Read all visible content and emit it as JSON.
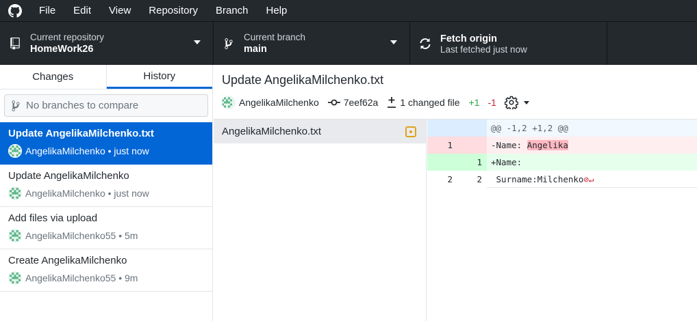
{
  "menu": {
    "items": [
      "File",
      "Edit",
      "View",
      "Repository",
      "Branch",
      "Help"
    ]
  },
  "toolbar": {
    "repository": {
      "label": "Current repository",
      "value": "HomeWork26"
    },
    "branch": {
      "label": "Current branch",
      "value": "main"
    },
    "fetch": {
      "label": "Fetch origin",
      "value": "Last fetched just now"
    }
  },
  "sidebar": {
    "tabs": {
      "changes": "Changes",
      "history": "History"
    },
    "compare_placeholder": "No branches to compare",
    "commits": [
      {
        "title": "Update AngelikaMilchenko.txt",
        "meta": "AngelikaMilchenko • just now"
      },
      {
        "title": "Update AngelikaMilchenko",
        "meta": "AngelikaMilchenko • just now"
      },
      {
        "title": "Add files via upload",
        "meta": "AngelikaMilchenko55 • 5m"
      },
      {
        "title": "Create AngelikaMilchenko",
        "meta": "AngelikaMilchenko55 • 9m"
      }
    ]
  },
  "commit": {
    "title": "Update AngelikaMilchenko.txt",
    "author": "AngelikaMilchenko",
    "sha": "7eef62a",
    "changed_files": "1 changed file",
    "additions": "+1",
    "deletions": "-1"
  },
  "files": [
    {
      "name": "AngelikaMilchenko.txt",
      "status": "modified"
    }
  ],
  "diff": {
    "hunk": "@@ -1,2 +1,2 @@",
    "lines": [
      {
        "old": "1",
        "new": "",
        "prefix": "-Name: ",
        "highlight": "Angelika"
      },
      {
        "old": "",
        "new": "1",
        "text": "+Name: "
      },
      {
        "old": "2",
        "new": "2",
        "text": " Surname:Milchenko"
      }
    ]
  },
  "colors": {
    "toolbar_bg": "#24292e",
    "accent": "#0366d6",
    "addition": "#28a745",
    "deletion": "#cb2431",
    "modified": "#e0a21a"
  }
}
